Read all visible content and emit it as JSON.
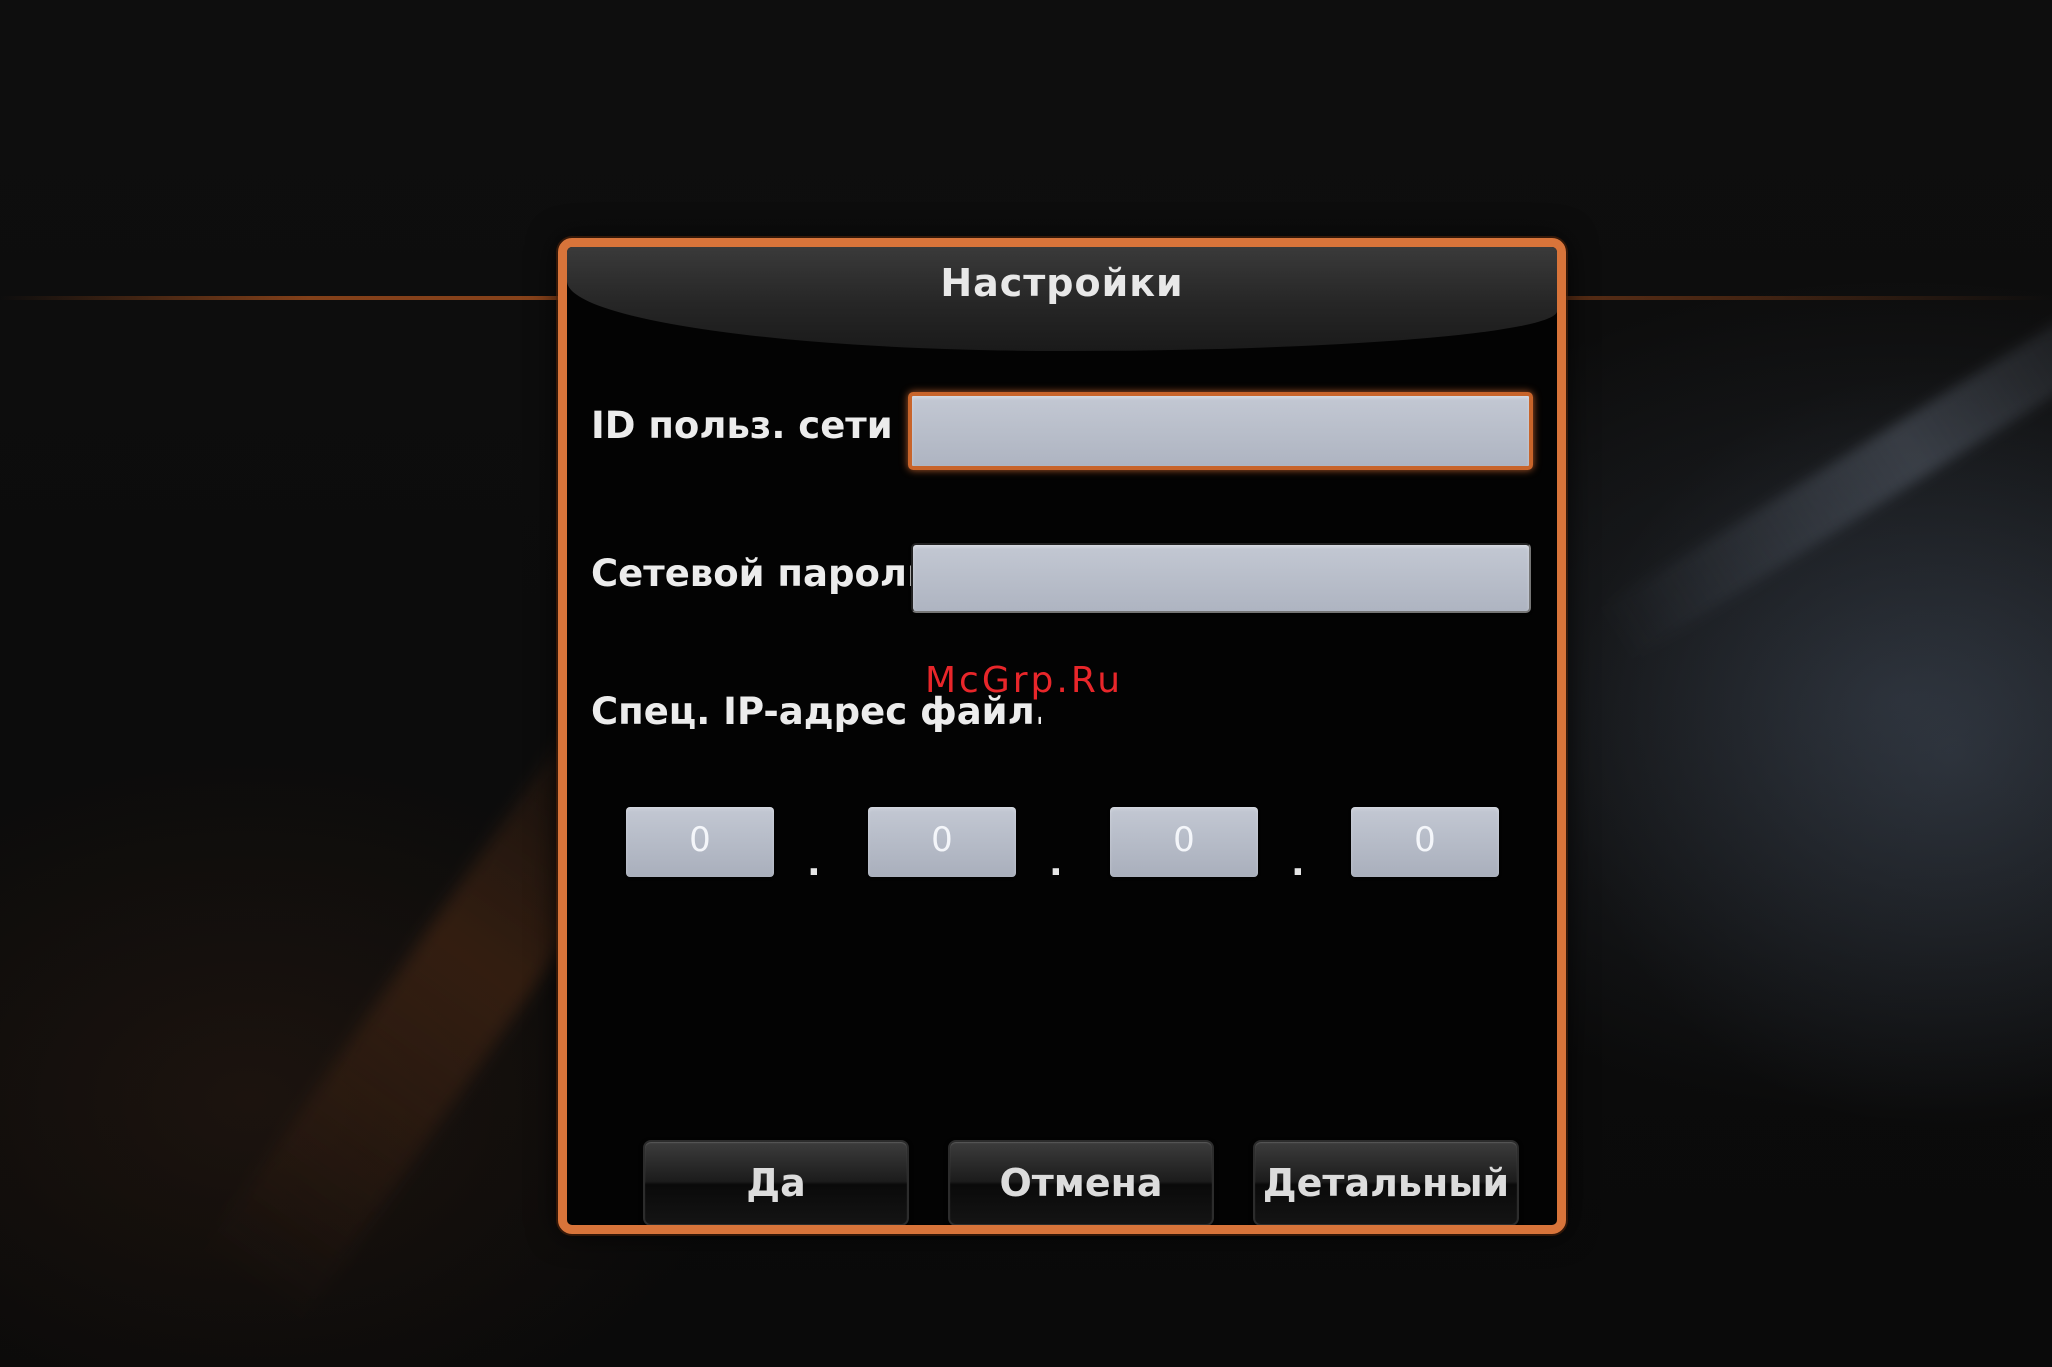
{
  "dialog": {
    "title": "Настройки",
    "accent_color": "#d8743a",
    "fields": {
      "user_id": {
        "label": "ID польз. сети",
        "value": "",
        "focused": true
      },
      "password": {
        "label": "Сетевой пароль",
        "value": ""
      },
      "server_ip": {
        "label": "Спец. IP-адрес файл. сер",
        "octets": [
          "0",
          "0",
          "0",
          "0"
        ],
        "separator": "."
      }
    },
    "buttons": {
      "ok": "Да",
      "cancel": "Отмена",
      "advanced": "Детальный"
    }
  },
  "watermark": {
    "text": "McGrp.Ru",
    "color": "#e8262a"
  }
}
